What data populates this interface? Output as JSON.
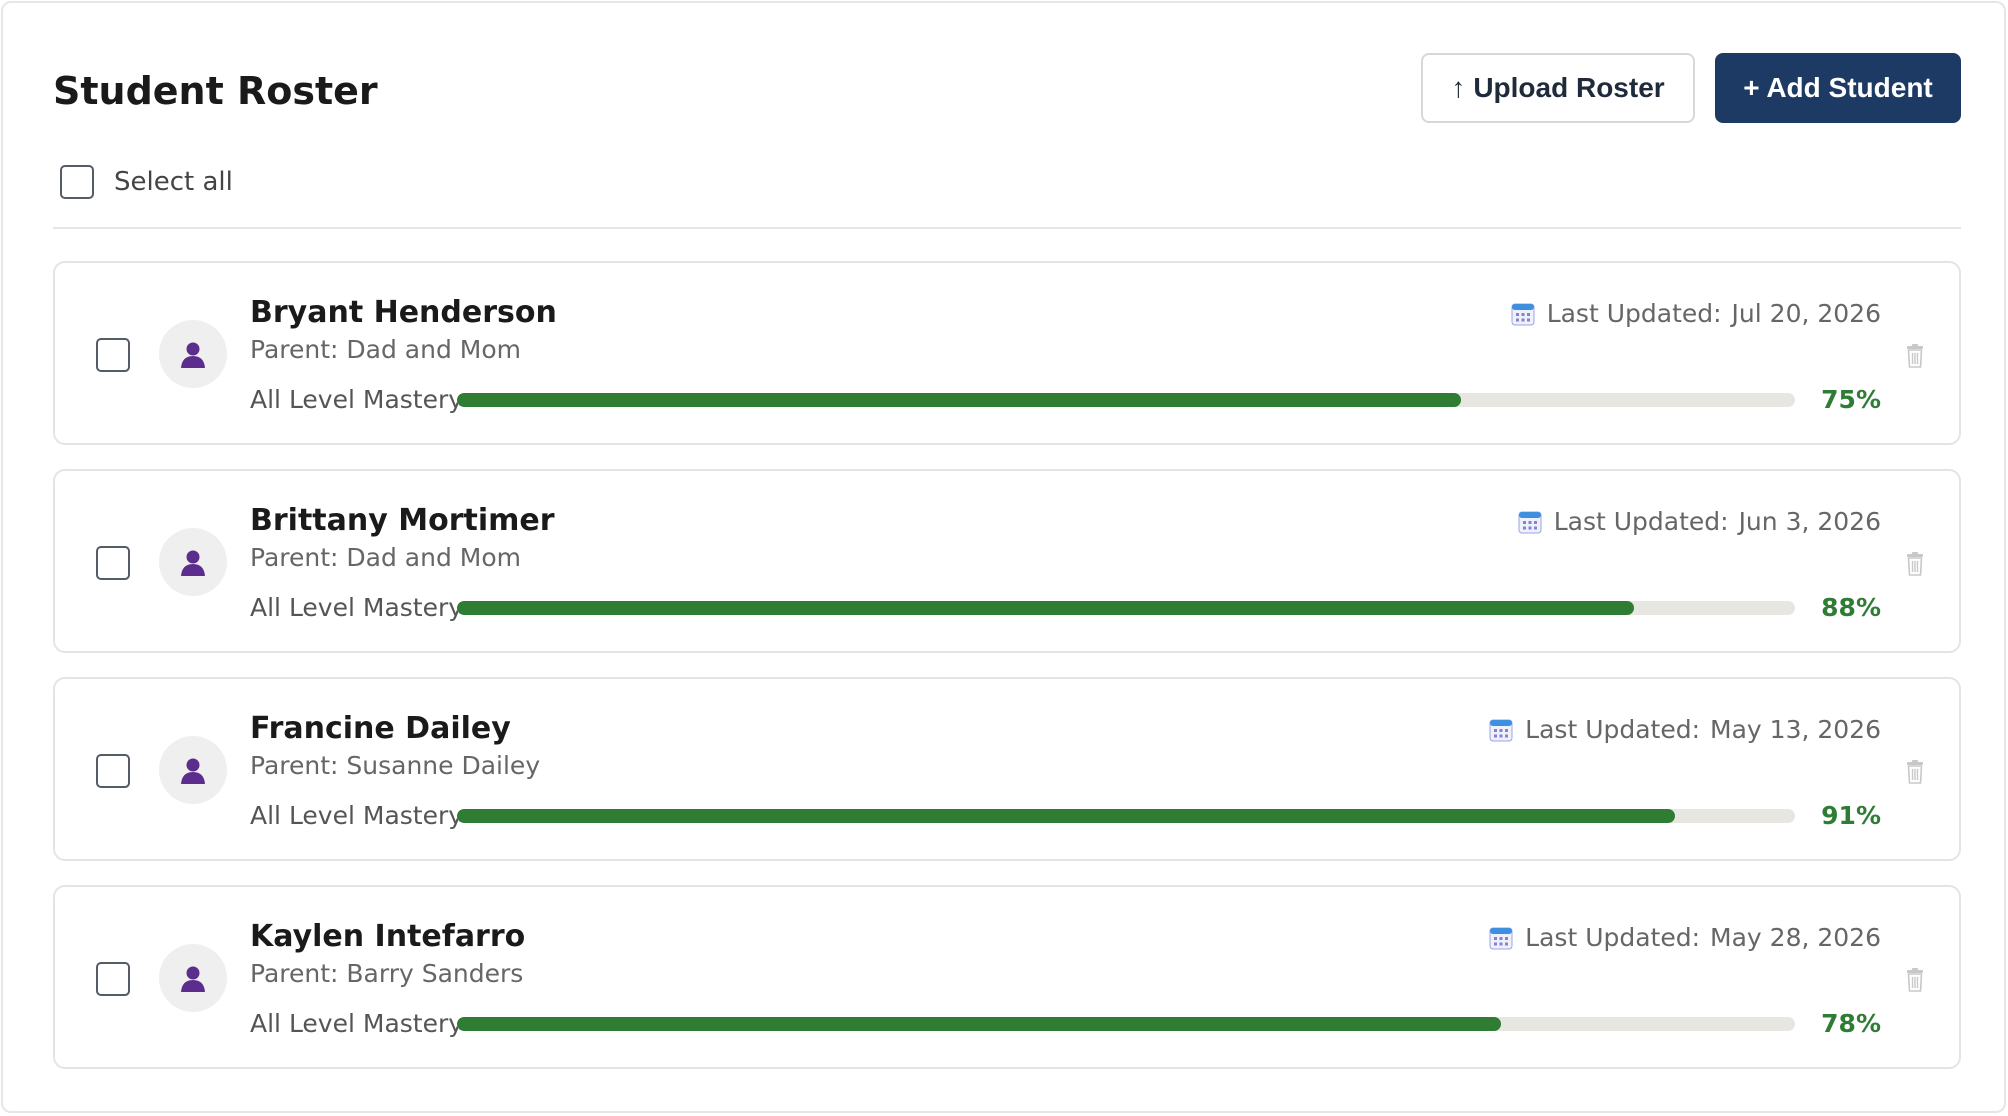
{
  "header": {
    "title": "Student Roster",
    "upload_glyph": "↑",
    "upload_label": "Upload Roster",
    "add_label": "+ Add Student"
  },
  "select_all": {
    "label": "Select all",
    "checked": false
  },
  "icons": {
    "avatar": "person-icon",
    "calendar": "calendar-icon",
    "delete": "trash-icon"
  },
  "colors": {
    "accent": "#1c3a63",
    "progress": "#2f7d34",
    "track": "#e8e6e1",
    "avatar_figure": "#5b2d8c"
  },
  "students": [
    {
      "name": "Bryant Henderson",
      "parent": "Parent: Dad and Mom",
      "updated_label": "Last Updated:",
      "updated_date": "Jul 20, 2026",
      "mastery_label": "All Level Mastery",
      "mastery": 75,
      "mastery_text": "75%"
    },
    {
      "name": "Brittany Mortimer",
      "parent": "Parent: Dad and Mom",
      "updated_label": "Last Updated:",
      "updated_date": "Jun 3, 2026",
      "mastery_label": "All Level Mastery",
      "mastery": 88,
      "mastery_text": "88%"
    },
    {
      "name": "Francine Dailey",
      "parent": "Parent: Susanne Dailey",
      "updated_label": "Last Updated:",
      "updated_date": "May 13, 2026",
      "mastery_label": "All Level Mastery",
      "mastery": 91,
      "mastery_text": "91%"
    },
    {
      "name": "Kaylen Intefarro",
      "parent": "Parent: Barry Sanders",
      "updated_label": "Last Updated:",
      "updated_date": "May 28, 2026",
      "mastery_label": "All Level Mastery",
      "mastery": 78,
      "mastery_text": "78%"
    }
  ]
}
